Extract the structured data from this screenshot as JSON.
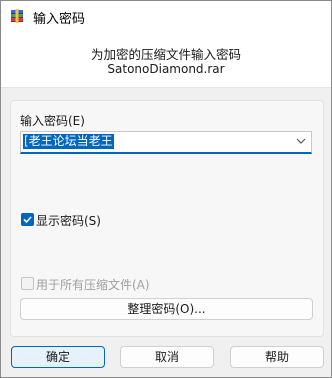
{
  "window": {
    "title": "输入密码"
  },
  "header": {
    "line1": "为加密的压缩文件输入密码",
    "filename": "SatonoDiamond.rar"
  },
  "password": {
    "label": "输入密码(E)",
    "value": "[老王论坛当老王"
  },
  "show_password": {
    "label": "显示密码(S)",
    "checked": true
  },
  "use_all_archives": {
    "label": "用于所有压缩文件(A)",
    "checked": false,
    "enabled": false
  },
  "organize_button": {
    "label": "整理密码(O)..."
  },
  "footer": {
    "ok": "确定",
    "cancel": "取消",
    "help": "帮助"
  },
  "colors": {
    "accent": "#0067c0",
    "default_button_bg": "#e5f1fb"
  }
}
